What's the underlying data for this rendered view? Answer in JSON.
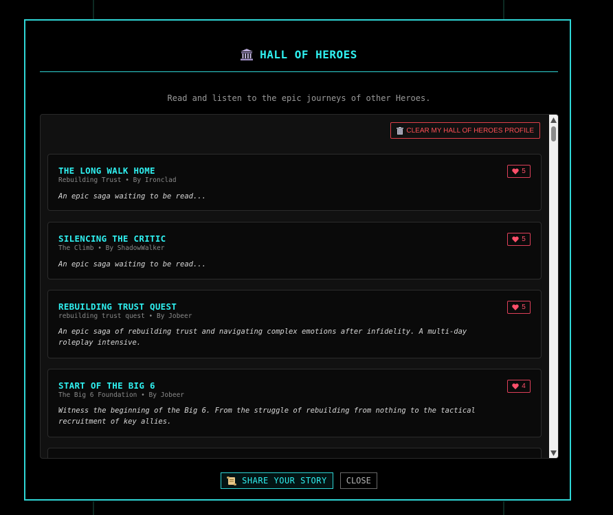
{
  "modal": {
    "title": "HALL OF HEROES",
    "title_icon": "classical-building-icon",
    "subtitle": "Read and listen to the epic journeys of other Heroes."
  },
  "toolbar": {
    "clear_label": "CLEAR MY HALL OF HEROES PROFILE",
    "clear_icon": "trash-icon"
  },
  "stories": [
    {
      "title": "THE LONG WALK HOME",
      "meta": "Rebuilding Trust • By Ironclad",
      "description": "An epic saga waiting to be read...",
      "likes": "5"
    },
    {
      "title": "SILENCING THE CRITIC",
      "meta": "The Climb • By ShadowWalker",
      "description": "An epic saga waiting to be read...",
      "likes": "5"
    },
    {
      "title": "REBUILDING TRUST QUEST",
      "meta": "rebuilding trust quest • By Jobeer",
      "description": "An epic saga of rebuilding trust and navigating complex emotions after infidelity. A multi-day roleplay intensive.",
      "likes": "5"
    },
    {
      "title": "START OF THE BIG 6",
      "meta": "The Big 6 Foundation • By Jobeer",
      "description": "Witness the beginning of the Big 6. From the struggle of rebuilding from nothing to the tactical recruitment of key allies.",
      "likes": "4"
    }
  ],
  "footer": {
    "share_label": "SHARE YOUR STORY",
    "share_icon": "scroll-icon",
    "close_label": "CLOSE"
  },
  "colors": {
    "accent": "#2ff0f0",
    "danger": "#ff4f55",
    "background": "#000000"
  }
}
